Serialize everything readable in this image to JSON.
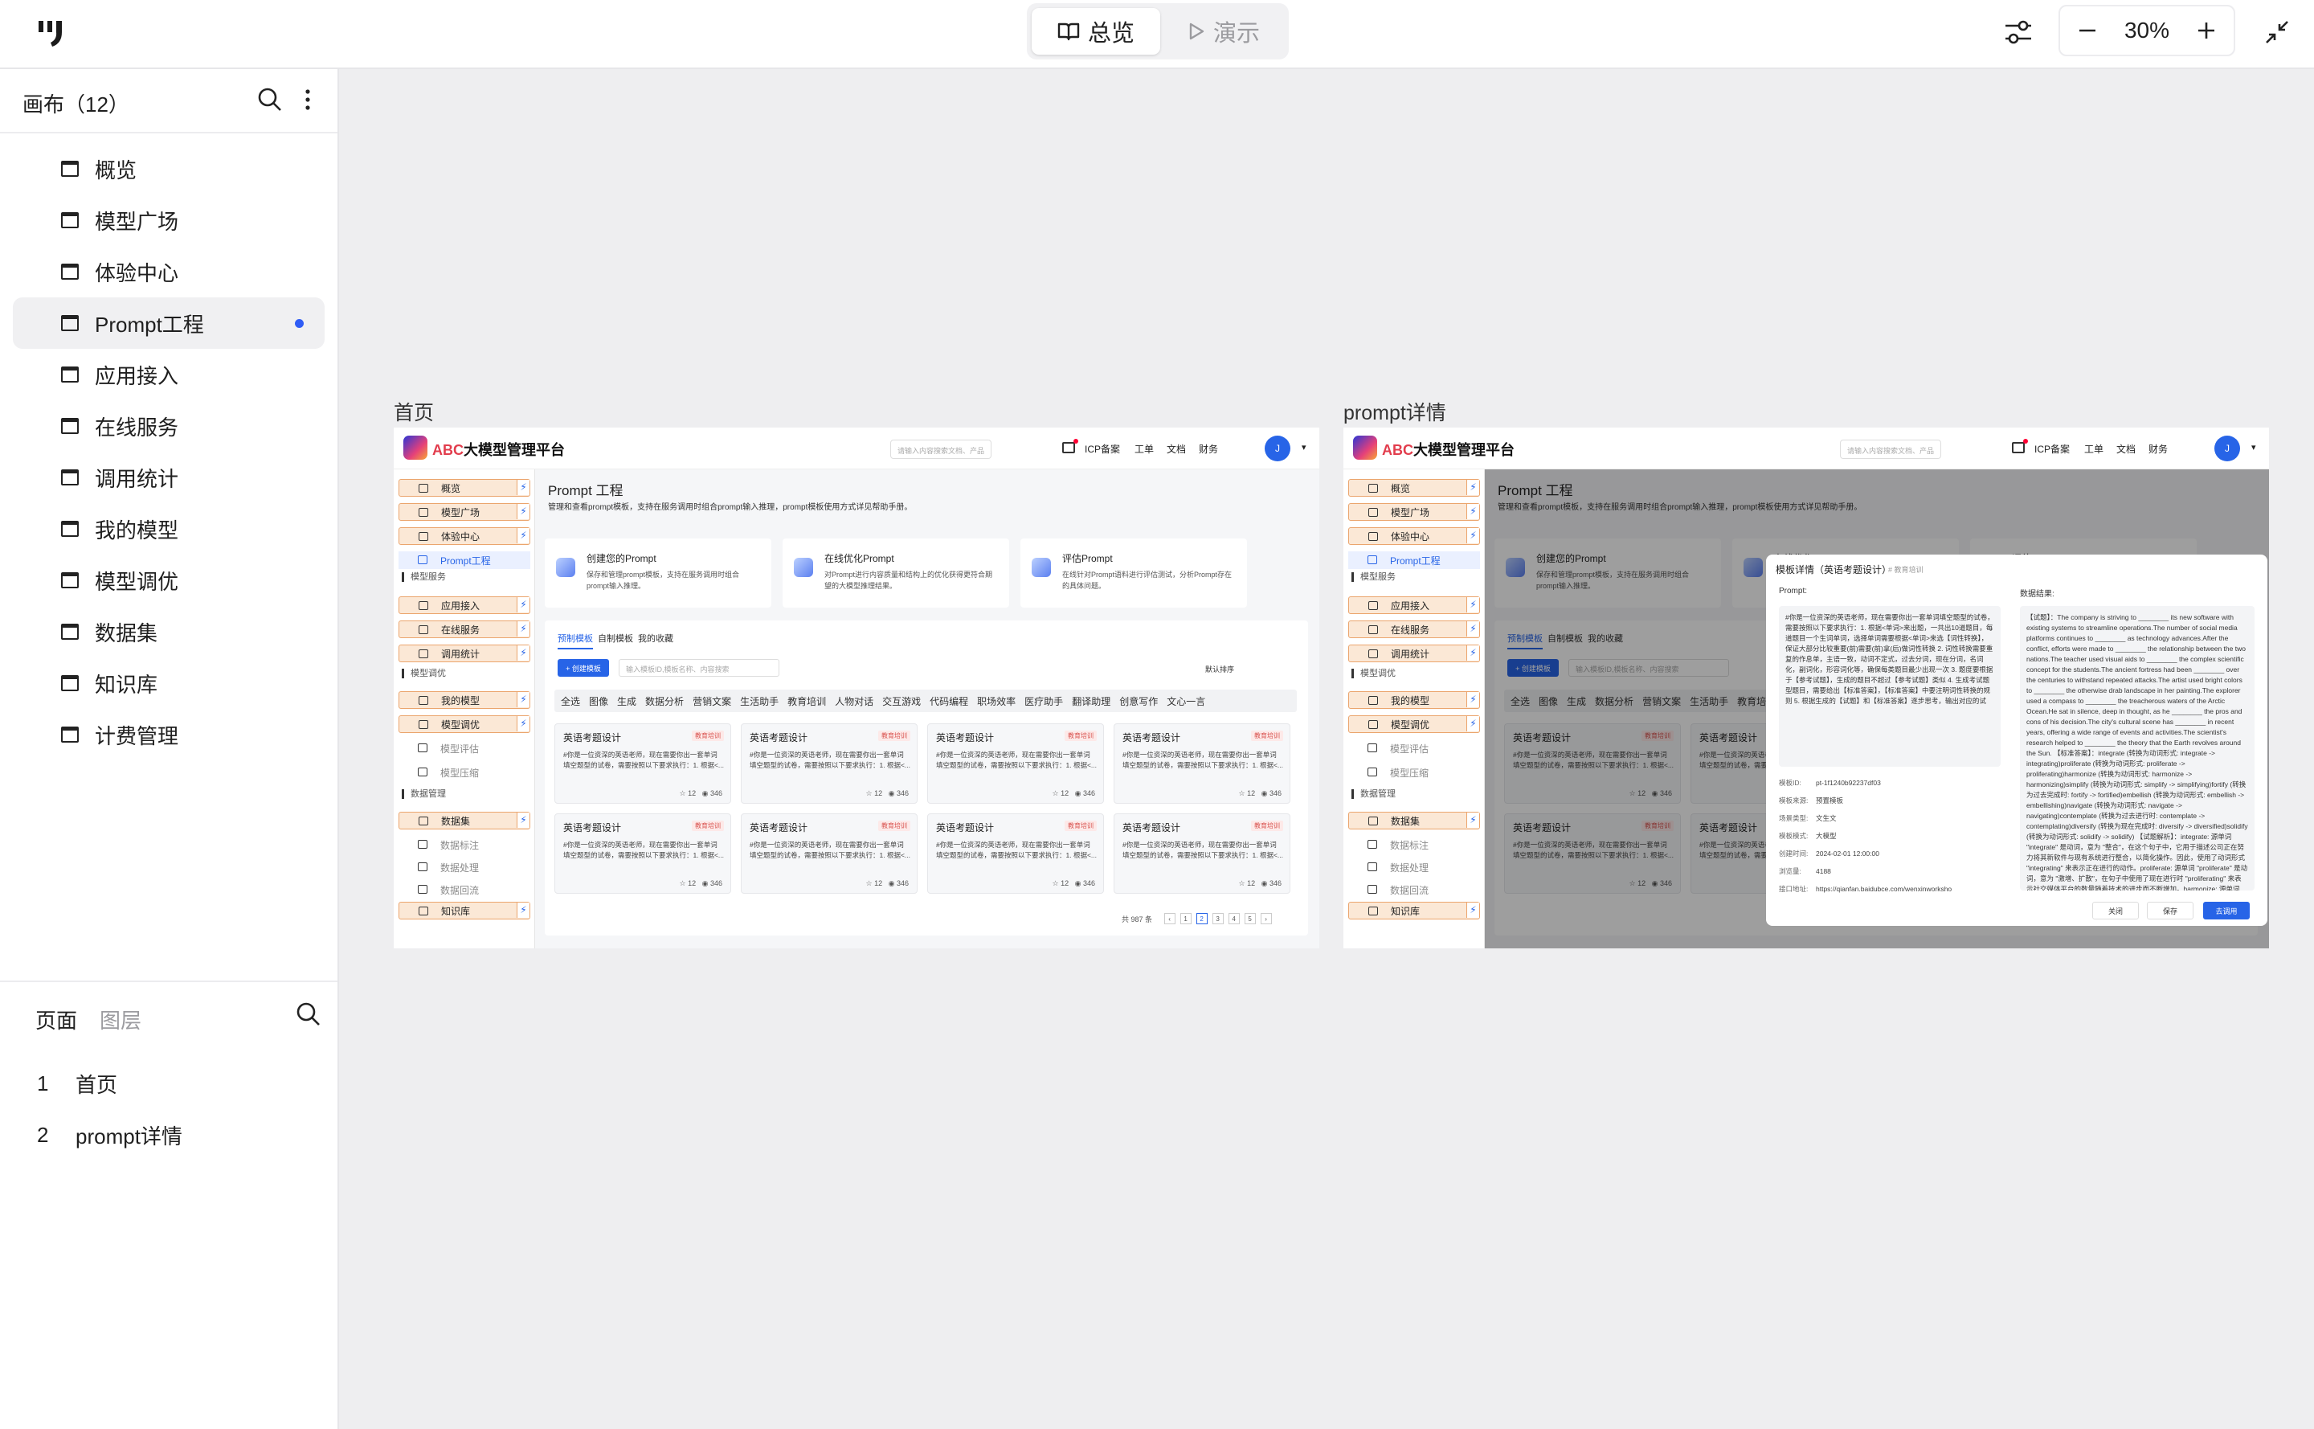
{
  "topbar": {
    "modes": {
      "overview": "总览",
      "present": "演示"
    },
    "zoom": "30%"
  },
  "sidebar": {
    "title": "画布（12）",
    "canvases": [
      {
        "label": "概览"
      },
      {
        "label": "模型广场"
      },
      {
        "label": "体验中心"
      },
      {
        "label": "Prompt工程",
        "active": true
      },
      {
        "label": "应用接入"
      },
      {
        "label": "在线服务"
      },
      {
        "label": "调用统计"
      },
      {
        "label": "我的模型"
      },
      {
        "label": "模型调优"
      },
      {
        "label": "数据集"
      },
      {
        "label": "知识库"
      },
      {
        "label": "计费管理"
      }
    ],
    "bottom_tabs": {
      "pages": "页面",
      "layers": "图层"
    },
    "pages": [
      {
        "num": "1",
        "label": "首页"
      },
      {
        "num": "2",
        "label": "prompt详情"
      }
    ]
  },
  "artboards": [
    {
      "label": "首页"
    },
    {
      "label": "prompt详情"
    }
  ],
  "mock": {
    "brand_abc": "ABC",
    "brand_rest": "大模型管理平台",
    "search_placeholder": "请输入内容搜索文档、产品",
    "nav": [
      "ICP备案",
      "工单",
      "文档",
      "财务"
    ],
    "avatar": "J",
    "side": {
      "items": [
        "概览",
        "模型广场",
        "体验中心",
        "Prompt工程",
        "应用接入",
        "在线服务",
        "调用统计",
        "我的模型",
        "模型调优",
        "模型评估",
        "模型压缩",
        "数据集",
        "数据标注",
        "数据处理",
        "数据回流",
        "知识库"
      ],
      "groups": [
        "模型服务",
        "模型调优",
        "数据管理"
      ]
    },
    "page_title": "Prompt 工程",
    "page_sub": "管理和查看prompt模板，支持在服务调用时组合prompt输入推理，prompt模板使用方式详见帮助手册。",
    "cards": [
      {
        "title": "创建您的Prompt",
        "desc": "保存和管理prompt模板，支持在服务调用时组合prompt输入推理。"
      },
      {
        "title": "在线优化Prompt",
        "desc": "对Prompt进行内容质量和结构上的优化获得更符合期望的大模型推理结果。"
      },
      {
        "title": "评估Prompt",
        "desc": "在线针对Prompt语料进行评估测试，分析Prompt存在的具体问题。"
      }
    ],
    "tabs": [
      "预制模板",
      "自制模板",
      "我的收藏"
    ],
    "new_btn": "+ 创建模板",
    "filter_placeholder": "输入模板ID,模板名称、内容搜索",
    "sort": "默认排序",
    "categories": [
      "全选",
      "图像",
      "生成",
      "数据分析",
      "营销文案",
      "生活助手",
      "教育培训",
      "人物对话",
      "交互游戏",
      "代码编程",
      "职场效率",
      "医疗助手",
      "翻译助理",
      "创意写作",
      "文心一言"
    ],
    "template_title": "英语考题设计",
    "template_tag": "教育培训",
    "template_desc": "#你是一位资深的英语老师，现在需要你出一套单词填空题型的试卷，需要按照以下要求执行：1. 根据<...",
    "template_stars": "☆ 12",
    "template_views": "◉ 346",
    "pager_total": "共 987 条",
    "pager_pages": [
      "1",
      "2",
      "3",
      "4",
      "5"
    ]
  },
  "dialog": {
    "title": "模板详情（英语考题设计）",
    "tag": "# 教育培训",
    "prompt_label": "Prompt:",
    "prompt_text": "#你是一位资深的英语老师，现在需要你出一套单词填空题型的试卷，需要按照以下要求执行：1. 根据<单词>来出题，一共出10道题目，每道题目一个生词单词，选择单词需要根据<单词>来选【词性转换】，保证大部分比较重要(前)需要(前)拿(后)做词性转换 2. 词性转换需要重复的作息单，主语一致，动词不定式，过去分词，现在分词，名词化，副词化，形容词化等，确保每类题目最少出现一次 3. 题度要根据于【参考试题】，生成的题目不超过【参考试题】类似 4. 生成考试题型题目，需要给出【标准答案】，【标准答案】中要注明词性转换的规则 5. 根据生成的【试题】和【标准答案】逐步思考，输出对应的试",
    "result_label": "数据结果:",
    "result_text": "【试题】：The company is striving to ________ its new software with existing systems to streamline operations.The number of social media platforms continues to ________ as technology advances.After the conflict, efforts were made to ________ the relationship between the two nations.The teacher used visual aids to ________ the complex scientific concept for the students.The ancient fortress had been ________ over the centuries to withstand repeated attacks.The artist used bright colors to ________ the otherwise drab landscape in her painting.The explorer used a compass to ________ the treacherous waters of the Arctic Ocean.He sat in silence, deep in thought, as he ________ the pros and cons of his decision.The city's cultural scene has ________ in recent years, offering a wide range of events and activities.The scientist's research helped to ________ the theory that the Earth revolves around the Sun. 【标准答案】：integrate (转换为动词形式: integrate -> integrating)proliferate (转换为动词形式: proliferate -> proliferating)harmonize (转换为动词形式: harmonize -> harmonizing)simplify (转换为动词形式: simplify -> simplifying)fortify (转换为过去完成时: fortify -> fortified)embellish (转换为动词形式: embellish -> embellishing)navigate (转换为动词形式: navigate -> navigating)contemplate (转换为过去进行时: contemplate -> contemplating)diversify (转换为现在完成时: diversify -> diversified)solidify (转换为动词形式: solidify -> solidify) 【试题解析】：integrate: 源单词 \"integrate\" 是动词，意为 \"整合\"，在这个句子中，它用于描述公司正在努力将其新软件与现有系统进行整合，以简化操作。因此，使用了动词形式 \"integrating\" 来表示正在进行的动作。proliferate: 源单词 \"proliferate\" 是动词，意为 \"激增、扩散\"，在句子中使用了现在进行时 \"proliferating\" 来表示社交媒体平台的数量随着技术的进步而不断增加。harmonize: 源单词 \"harmonize\" 是动词，意为 \"协调\"，在句子中使用了...",
    "meta": [
      {
        "k": "模板ID:",
        "v": "pt-1f1240b92237df03"
      },
      {
        "k": "模板来源:",
        "v": "预置模板"
      },
      {
        "k": "场景类型:",
        "v": "文生文"
      },
      {
        "k": "模板模式:",
        "v": "大模型"
      },
      {
        "k": "创建时间:",
        "v": "2024-02-01 12:00:00"
      },
      {
        "k": "浏览量:",
        "v": "4188"
      },
      {
        "k": "接口地址:",
        "v": "https://qianfan.baidubce.com/wenxinworksho"
      }
    ],
    "buttons": {
      "close": "关闭",
      "save": "保存",
      "copy": "去调用"
    }
  }
}
